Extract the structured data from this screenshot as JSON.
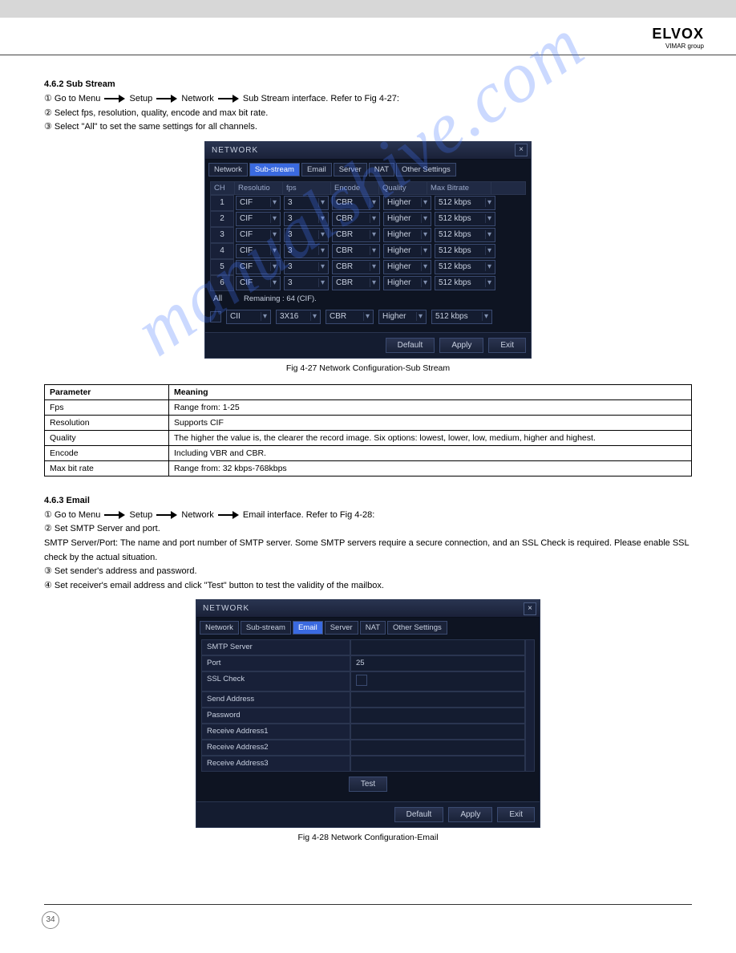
{
  "logo": {
    "brand": "ELVOX",
    "sub": "VIMAR group"
  },
  "sec1": {
    "title": "4.6.2 Sub Stream",
    "step1_pre": "① Go to Menu",
    "step1_a": "Setup",
    "step1_b": "Network",
    "step1_c": "Sub Stream interface. Refer to Fig 4-27:",
    "step2": "② Select fps, resolution, quality, encode and max bit rate.",
    "step3": "③ Select \"All\" to set the same settings for all channels."
  },
  "dialog1": {
    "title": "NETWORK",
    "tabs": [
      "Network",
      "Sub-stream",
      "Email",
      "Server",
      "NAT",
      "Other Settings"
    ],
    "activeTab": 1,
    "columns": {
      "ch": "CH",
      "res": "Resolutio",
      "fps": "fps",
      "enc": "Encode",
      "q": "Quality",
      "mb": "Max Bitrate"
    },
    "rows": [
      {
        "ch": "1",
        "res": "CIF",
        "fps": "3",
        "enc": "CBR",
        "q": "Higher",
        "mb": "512 kbps"
      },
      {
        "ch": "2",
        "res": "CIF",
        "fps": "3",
        "enc": "CBR",
        "q": "Higher",
        "mb": "512 kbps"
      },
      {
        "ch": "3",
        "res": "CIF",
        "fps": "3",
        "enc": "CBR",
        "q": "Higher",
        "mb": "512 kbps"
      },
      {
        "ch": "4",
        "res": "CIF",
        "fps": "3",
        "enc": "CBR",
        "q": "Higher",
        "mb": "512 kbps"
      },
      {
        "ch": "5",
        "res": "CIF",
        "fps": "3",
        "enc": "CBR",
        "q": "Higher",
        "mb": "512 kbps"
      },
      {
        "ch": "6",
        "res": "CIF",
        "fps": "3",
        "enc": "CBR",
        "q": "Higher",
        "mb": "512 kbps"
      }
    ],
    "allLabel": "All",
    "remaining": "Remaining : 64 (CIF).",
    "allRow": {
      "res": "CII",
      "fps": "3X16",
      "enc": "CBR",
      "q": "Higher",
      "mb": "512 kbps"
    },
    "btns": {
      "def": "Default",
      "apply": "Apply",
      "exit": "Exit"
    }
  },
  "caption1": "Fig 4-27 Network Configuration-Sub Stream",
  "paramsTable": {
    "head": {
      "p": "Parameter",
      "m": "Meaning"
    },
    "rows": [
      {
        "p": "Fps",
        "m": "Range from: 1-25"
      },
      {
        "p": "Resolution",
        "m": "Supports CIF"
      },
      {
        "p": "Quality",
        "m": "The higher the value is, the clearer the record image. Six options: lowest, lower, low, medium, higher and highest."
      },
      {
        "p": "Encode",
        "m": "Including VBR and CBR."
      },
      {
        "p": "Max bit rate",
        "m": "Range from: 32 kbps-768kbps"
      }
    ]
  },
  "sec2": {
    "title": "4.6.3 Email",
    "step1_pre": "① Go to Menu",
    "step1_a": "Setup",
    "step1_b": "Network",
    "step1_c": "Email interface. Refer to Fig 4-28:",
    "lines": [
      "② Set SMTP Server and port.",
      "SMTP Server/Port: The name and port number of SMTP server. Some SMTP servers require a secure connection, and an SSL Check is required. Please enable SSL check by the actual situation.",
      "③ Set sender's address and password.",
      "④ Set receiver's email address and click \"Test\" button to test the validity of the mailbox."
    ]
  },
  "dialog2": {
    "title": "NETWORK",
    "tabs": [
      "Network",
      "Sub-stream",
      "Email",
      "Server",
      "NAT",
      "Other Settings"
    ],
    "activeTab": 2,
    "fields": [
      {
        "label": "SMTP Server",
        "value": ""
      },
      {
        "label": "Port",
        "value": "25"
      },
      {
        "label": "SSL Check",
        "value": "",
        "checkbox": true
      },
      {
        "label": "Send Address",
        "value": ""
      },
      {
        "label": "Password",
        "value": ""
      },
      {
        "label": "Receive Address1",
        "value": ""
      },
      {
        "label": "Receive Address2",
        "value": ""
      },
      {
        "label": "Receive Address3",
        "value": ""
      }
    ],
    "test": "Test",
    "btns": {
      "def": "Default",
      "apply": "Apply",
      "exit": "Exit"
    }
  },
  "caption2": "Fig 4-28 Network Configuration-Email",
  "page": "34",
  "watermark": "manualshive.com"
}
